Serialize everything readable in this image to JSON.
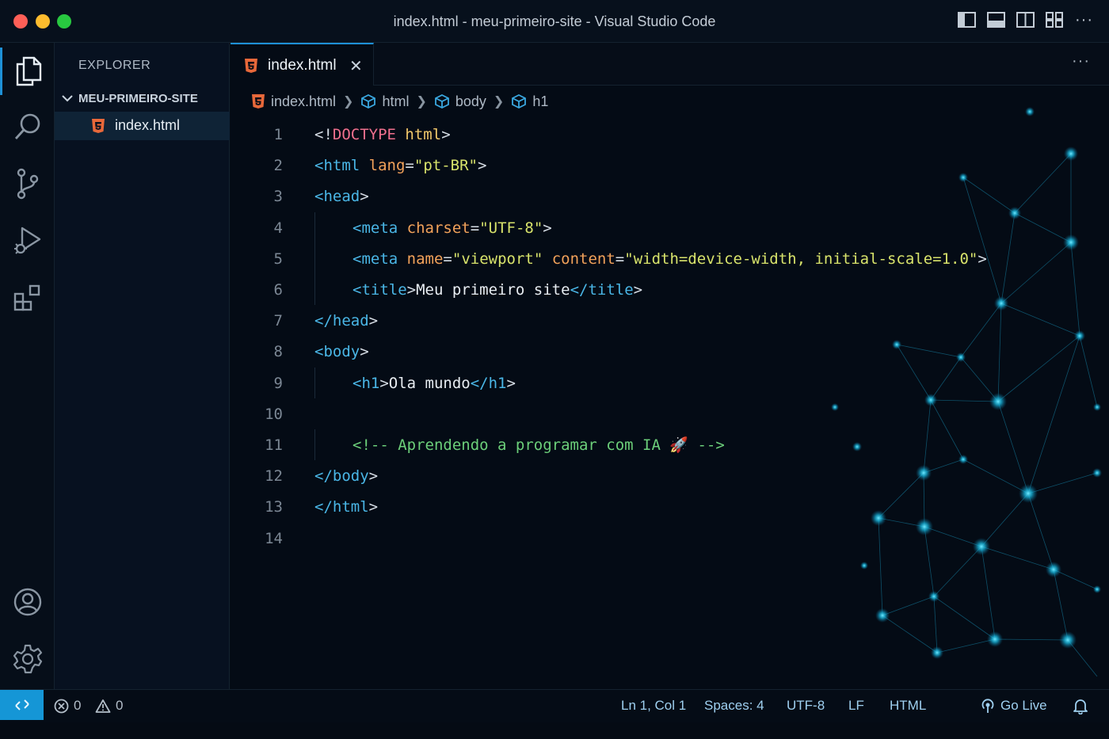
{
  "window": {
    "title": "index.html - meu-primeiro-site - Visual Studio Code"
  },
  "activity_bar": {
    "items": [
      "explorer-icon",
      "search-icon",
      "source-control-icon",
      "run-debug-icon",
      "extensions-icon",
      "account-icon",
      "settings-gear-icon"
    ],
    "accent": "#1e90d6"
  },
  "sidebar": {
    "title": "EXPLORER",
    "folder": "MEU-PRIMEIRO-SITE",
    "files": [
      {
        "name": "index.html",
        "icon": "html5-icon",
        "selected": true
      }
    ]
  },
  "tabs": [
    {
      "label": "index.html",
      "active": true,
      "close": "✕"
    }
  ],
  "tab_actions": "···",
  "breadcrumb": [
    "index.html",
    "html",
    "body",
    "h1"
  ],
  "code": {
    "line_numbers": [
      "1",
      "2",
      "3",
      "4",
      "5",
      "6",
      "7",
      "8",
      "9",
      "10",
      "11",
      "12",
      "13",
      "14"
    ],
    "lines": [
      {
        "n": "1",
        "tokens": [
          [
            "eq",
            "<!"
          ],
          [
            "doctype",
            "DOCTYPE"
          ],
          [
            "eq",
            " "
          ],
          [
            "kw",
            "html"
          ],
          [
            "eq",
            ">"
          ]
        ]
      },
      {
        "n": "2",
        "tokens": [
          [
            "tag",
            "<html"
          ],
          [
            "eq",
            " "
          ],
          [
            "attr",
            "lang"
          ],
          [
            "eq",
            "="
          ],
          [
            "str",
            "\"pt-BR\""
          ],
          [
            "eq",
            ">"
          ]
        ]
      },
      {
        "n": "3",
        "tokens": [
          [
            "tag",
            "<head"
          ],
          [
            "eq",
            ">"
          ]
        ]
      },
      {
        "n": "4",
        "indent": true,
        "tokens": [
          [
            "tag",
            "<meta"
          ],
          [
            "eq",
            " "
          ],
          [
            "attr",
            "charset"
          ],
          [
            "eq",
            "="
          ],
          [
            "str",
            "\"UTF-8\""
          ],
          [
            "eq",
            ">"
          ]
        ]
      },
      {
        "n": "5",
        "indent": true,
        "tokens": [
          [
            "tag",
            "<meta"
          ],
          [
            "eq",
            " "
          ],
          [
            "attr",
            "name"
          ],
          [
            "eq",
            "="
          ],
          [
            "str",
            "\"viewport\""
          ],
          [
            "eq",
            " "
          ],
          [
            "attr",
            "content"
          ],
          [
            "eq",
            "="
          ],
          [
            "str",
            "\"width=device-width, initial-scale=1.0\""
          ],
          [
            "eq",
            ">"
          ]
        ]
      },
      {
        "n": "6",
        "indent": true,
        "tokens": [
          [
            "tag",
            "<title"
          ],
          [
            "eq",
            ">"
          ],
          [
            "txt",
            "Meu primeiro site"
          ],
          [
            "tag",
            "</title"
          ],
          [
            "eq",
            ">"
          ]
        ]
      },
      {
        "n": "7",
        "tokens": [
          [
            "tag",
            "</head"
          ],
          [
            "eq",
            ">"
          ]
        ]
      },
      {
        "n": "8",
        "tokens": [
          [
            "tag",
            "<body"
          ],
          [
            "eq",
            ">"
          ]
        ]
      },
      {
        "n": "9",
        "indent": true,
        "tokens": [
          [
            "tag",
            "<h1"
          ],
          [
            "eq",
            ">"
          ],
          [
            "txt",
            "Ola mundo"
          ],
          [
            "tag",
            "</h1"
          ],
          [
            "eq",
            ">"
          ]
        ]
      },
      {
        "n": "10",
        "tokens": []
      },
      {
        "n": "11",
        "indent": true,
        "tokens": [
          [
            "cmt",
            "<!-- Aprendendo a programar com IA 🚀 -->"
          ]
        ]
      },
      {
        "n": "12",
        "tokens": [
          [
            "tag",
            "</body"
          ],
          [
            "eq",
            ">"
          ]
        ]
      },
      {
        "n": "13",
        "tokens": [
          [
            "tag",
            "</html"
          ],
          [
            "eq",
            ">"
          ]
        ]
      },
      {
        "n": "14",
        "tokens": []
      }
    ]
  },
  "statusbar": {
    "errors": "0",
    "warnings": "0",
    "position": "Ln 1, Col 1",
    "spaces": "Spaces: 4",
    "encoding": "UTF-8",
    "eol": "LF",
    "language": "HTML",
    "go_live": "Go Live"
  },
  "colors": {
    "tag": "#4ab6e6",
    "attribute": "#f2a25a",
    "string": "#d8e36b",
    "comment": "#6ccf7a",
    "html_icon": "#e8683a",
    "statusbar_accent": "#1596d6"
  }
}
